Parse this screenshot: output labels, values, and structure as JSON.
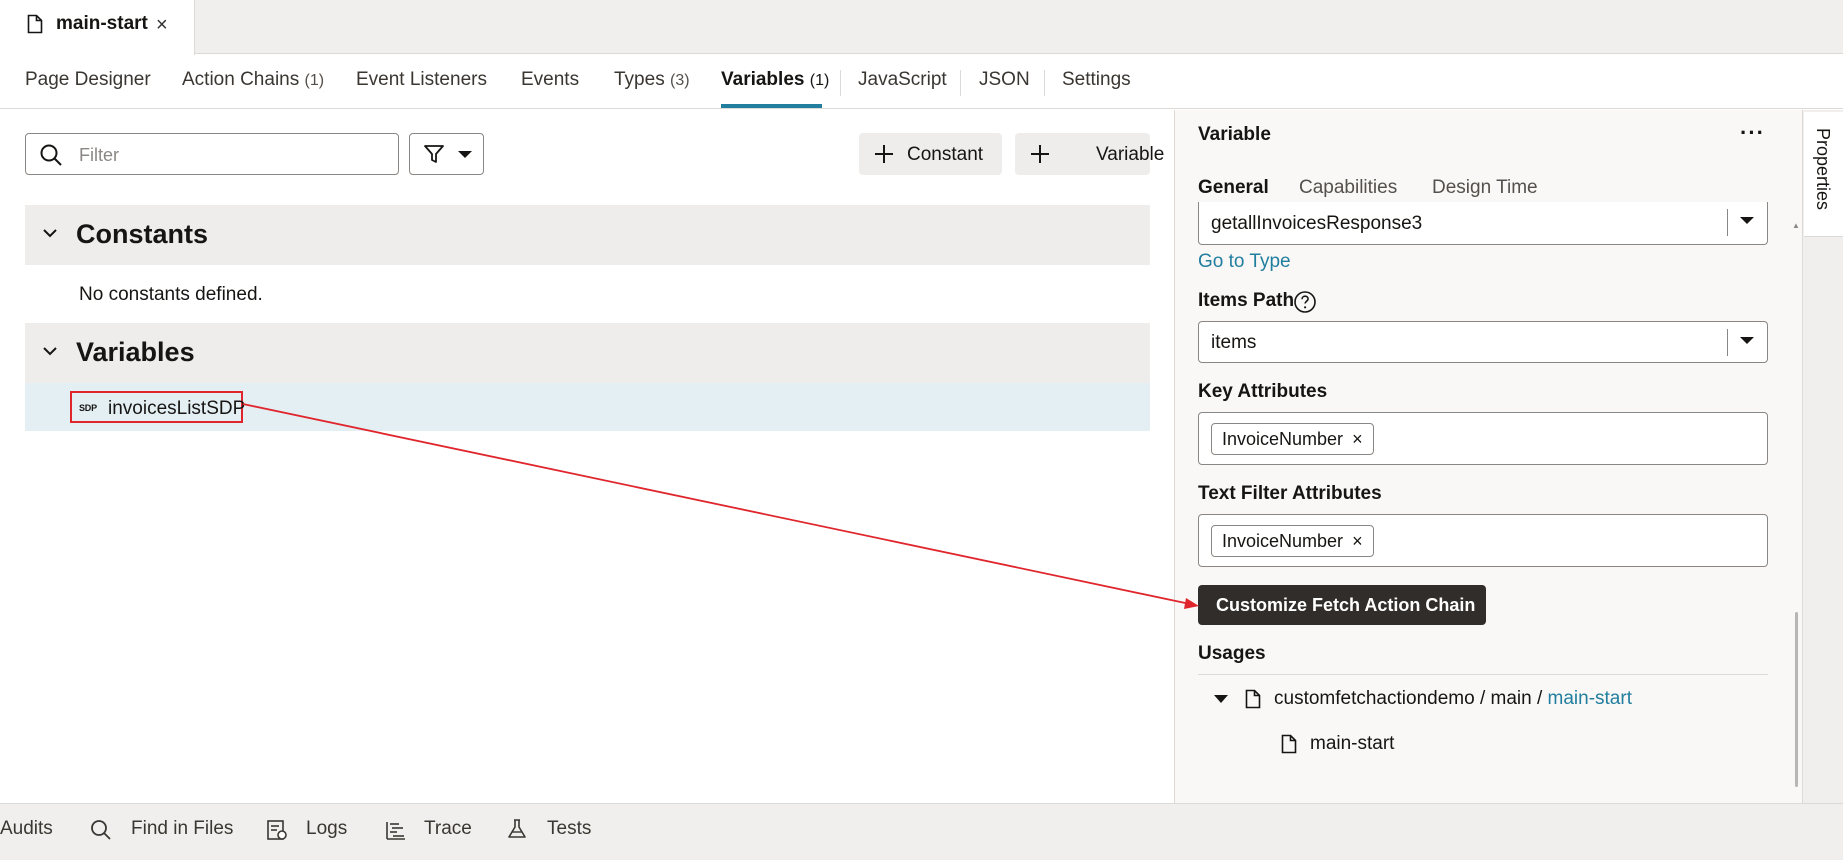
{
  "file_tab": {
    "name": "main-start",
    "close_icon": "×"
  },
  "nav_tabs": [
    {
      "label": "Page Designer",
      "count": ""
    },
    {
      "label": "Action Chains",
      "count": "(1)"
    },
    {
      "label": "Event Listeners",
      "count": ""
    },
    {
      "label": "Events",
      "count": ""
    },
    {
      "label": "Types",
      "count": "(3)"
    },
    {
      "label": "Variables",
      "count": "(1)"
    },
    {
      "label": "JavaScript",
      "count": ""
    },
    {
      "label": "JSON",
      "count": ""
    },
    {
      "label": "Settings",
      "count": ""
    }
  ],
  "active_nav_tab": "Variables",
  "toolbar": {
    "filter_placeholder": "Filter",
    "constant_button": "Constant",
    "variable_button": "Variable"
  },
  "constants": {
    "title": "Constants",
    "empty_text": "No constants defined."
  },
  "variables": {
    "title": "Variables",
    "items": [
      {
        "badge": "SDP",
        "name": "invoicesListSDP"
      }
    ]
  },
  "properties": {
    "header": "Variable",
    "more_icon": "···",
    "tabs": [
      "General",
      "Capabilities",
      "Design Time"
    ],
    "active_tab": "General",
    "type_value": "getallInvoicesResponse3",
    "goto_type_link": "Go to Type",
    "items_path_label": "Items Path",
    "items_path_value": "items",
    "key_attributes_label": "Key Attributes",
    "key_attributes": [
      "InvoiceNumber"
    ],
    "text_filter_label": "Text Filter Attributes",
    "text_filter_attributes": [
      "InvoiceNumber"
    ],
    "chip_remove_icon": "×",
    "fetch_button": "Customize Fetch Action Chain",
    "usages_label": "Usages",
    "usage_path_prefix": "customfetchactiondemo / main / ",
    "usage_path_link": "main-start",
    "usage_leaf": "main-start"
  },
  "side_tab": "Properties",
  "bottom_tools": [
    "Audits",
    "Find in Files",
    "Logs",
    "Trace",
    "Tests"
  ],
  "colors": {
    "accent": "#227e9e",
    "annotation": "#e0262d",
    "dark_button": "#312d2a"
  }
}
